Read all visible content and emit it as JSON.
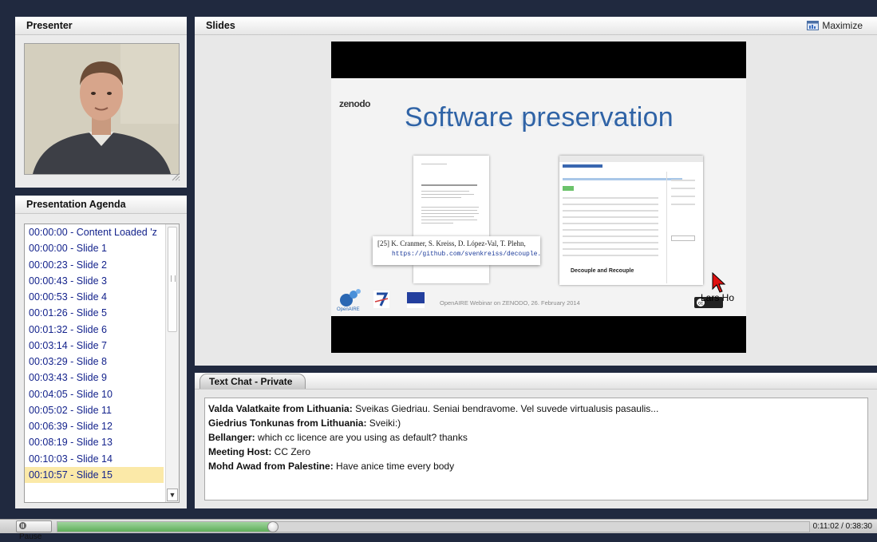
{
  "presenter": {
    "title": "Presenter"
  },
  "agenda": {
    "title": "Presentation Agenda",
    "items": [
      "00:00:00 - Content Loaded 'z",
      "00:00:00 - Slide 1",
      "00:00:23 - Slide 2",
      "00:00:43 - Slide 3",
      "00:00:53 - Slide 4",
      "00:01:26 - Slide 5",
      "00:01:32 - Slide 6",
      "00:03:14 - Slide 7",
      "00:03:29 - Slide 8",
      "00:03:43 - Slide 9",
      "00:04:05 - Slide 10",
      "00:05:02 - Slide 11",
      "00:06:39 - Slide 12",
      "00:08:19 - Slide 13",
      "00:10:03 - Slide 14",
      "00:10:57 - Slide 15"
    ],
    "active_index": 15
  },
  "slides": {
    "title": "Slides",
    "maximize_label": "Maximize",
    "slide": {
      "logo": "zenodo",
      "title": "Software preservation",
      "citation_line1": "[25] K. Cranmer, S. Kreiss, D. López-Val, T. Plehn,",
      "citation_line2": "https://github.com/svenkreiss/decouple.",
      "browser_heading": "Decouple and Recouple",
      "footer": "OpenAIRE Webinar on ZENODO, 26. February 2014",
      "openaire_label": "OpenAIRE",
      "overlay_name": "Lars Ho"
    }
  },
  "chat": {
    "tab_label": "Text Chat - Private",
    "messages": [
      {
        "sender": "Valda Valatkaite from Lithuania:",
        "text": " Sveikas Giedriau. Seniai bendravome. Vel suvede virtualusis pasaulis..."
      },
      {
        "sender": "Giedrius Tonkunas from Lithuania:",
        "text": " Sveiki:)"
      },
      {
        "sender": "Bellanger:",
        "text": " which cc licence are you using as default? thanks"
      },
      {
        "sender": "Meeting Host:",
        "text": " CC Zero"
      },
      {
        "sender": "Mohd Awad from Palestine:",
        "text": " Have anice time every body"
      }
    ]
  },
  "playback": {
    "pause_label": "Pause",
    "elapsed": "0:11:02",
    "total": "0:38:30",
    "time_display": "0:11:02 / 0:38:30",
    "progress_fraction": 0.2866
  },
  "colors": {
    "background": "#20293f",
    "agenda_link": "#14238c",
    "agenda_active": "#fbe9a8",
    "slide_title": "#2f63a6",
    "progress_fill": "#5fae5a"
  }
}
